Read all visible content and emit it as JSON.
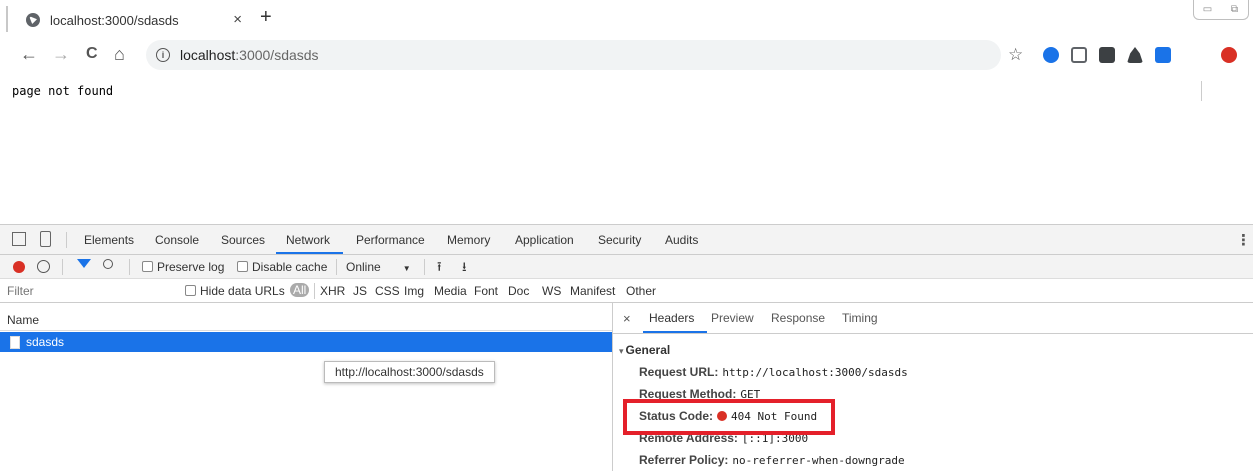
{
  "browser": {
    "tab": {
      "title": "localhost:3000/sdasds",
      "close": "×"
    },
    "new_tab": "+",
    "window_controls": {
      "minimize": "▭",
      "restore": "⧉"
    },
    "nav": {
      "back": "←",
      "forward": "→",
      "reload": "C",
      "home": "⌂"
    },
    "omnibox": {
      "host": "localhost",
      "path": ":3000/sdasds"
    },
    "star": "☆",
    "extensions": [
      {
        "name": "ext-plus-icon",
        "color": "#1a73e8"
      },
      {
        "name": "ext-copy-icon",
        "color": "#5f6368"
      },
      {
        "name": "ext-dots-icon",
        "color": "#3c4043"
      },
      {
        "name": "ext-agent-icon",
        "color": "#3c4043"
      },
      {
        "name": "ext-add-icon",
        "color": "#1a73e8"
      },
      {
        "name": "ext-stop-icon",
        "color": "#d93025"
      }
    ]
  },
  "page": {
    "text": "page not found"
  },
  "devtools": {
    "tabs": [
      "Elements",
      "Console",
      "Sources",
      "Network",
      "Performance",
      "Memory",
      "Application",
      "Security",
      "Audits"
    ],
    "active_tab": "Network",
    "more_menu": "⋮",
    "toolbar": {
      "preserve_log": "Preserve log",
      "disable_cache": "Disable cache",
      "throttle": "Online",
      "throttle_caret": "▼",
      "upload": "⭱",
      "download": "⭳"
    },
    "filter": {
      "placeholder": "Filter",
      "hide_data_urls": "Hide data URLs",
      "types": [
        "All",
        "XHR",
        "JS",
        "CSS",
        "Img",
        "Media",
        "Font",
        "Doc",
        "WS",
        "Manifest",
        "Other"
      ]
    },
    "requests": {
      "header": "Name",
      "rows": [
        {
          "name": "sdasds"
        }
      ],
      "tooltip": "http://localhost:3000/sdasds"
    },
    "detail": {
      "close": "×",
      "tabs": [
        "Headers",
        "Preview",
        "Response",
        "Timing"
      ],
      "active_tab": "Headers",
      "section": "General",
      "section_caret": "▾",
      "fields": {
        "request_url_k": "Request URL:",
        "request_url_v": "http://localhost:3000/sdasds",
        "request_method_k": "Request Method:",
        "request_method_v": "GET",
        "status_code_k": "Status Code:",
        "status_code_v": "404 Not Found",
        "remote_address_k": "Remote Address:",
        "remote_address_v": "[::1]:3000",
        "referrer_policy_k": "Referrer Policy:",
        "referrer_policy_v": "no-referrer-when-downgrade"
      },
      "status_color": "#d93025",
      "highlight_color": "#e4202a"
    }
  }
}
